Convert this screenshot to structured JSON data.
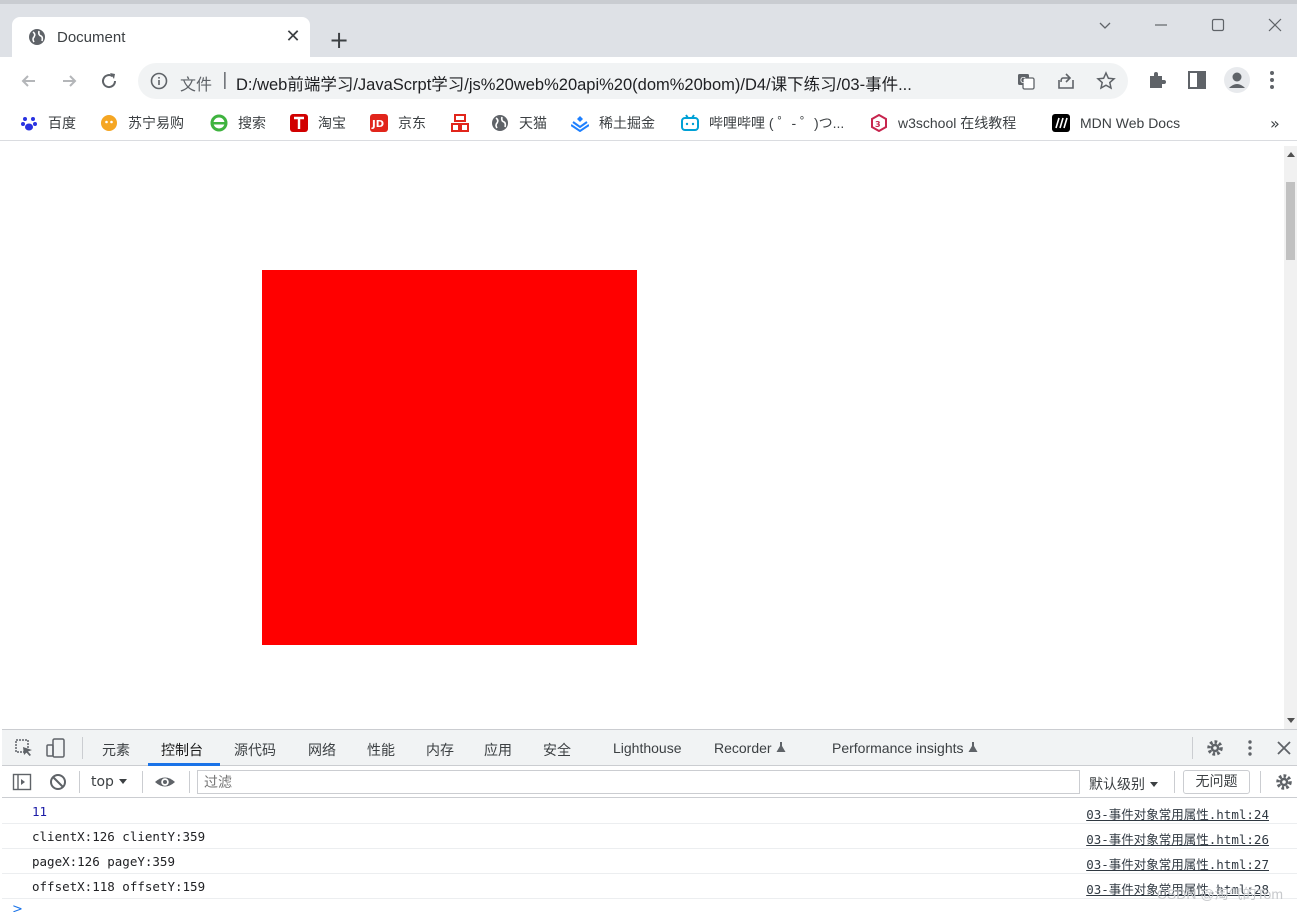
{
  "tab": {
    "title": "Document",
    "close_glyph": "✕"
  },
  "window": {
    "new_tab_glyph": "+"
  },
  "omnibox": {
    "scheme_label": "文件",
    "separator": "|",
    "url": "D:/web前端学习/JavaScrpt学习/js%20web%20api%20(dom%20bom)/D4/课下练习/03-事件..."
  },
  "bookmarks": [
    {
      "label": "百度",
      "icon": "baidu-icon",
      "color": "#2932e1"
    },
    {
      "label": "苏宁易购",
      "icon": "suning-icon",
      "color": "#f5a623"
    },
    {
      "label": "搜索",
      "icon": "search-engine-icon",
      "color": "#3fb33f"
    },
    {
      "label": "淘宝",
      "icon": "taobao-icon",
      "color": "#d10000"
    },
    {
      "label": "京东",
      "icon": "jd-icon",
      "color": "#e1251b"
    },
    {
      "label": "",
      "icon": "grid-logo-icon",
      "color": "#e1251b"
    },
    {
      "label": "天猫",
      "icon": "globe-icon",
      "color": "#5f6368"
    },
    {
      "label": "稀土掘金",
      "icon": "juejin-icon",
      "color": "#1e80ff"
    },
    {
      "label": "哔哩哔哩 ( ゜- ゜)つ...",
      "icon": "bilibili-icon",
      "color": "#00a1d6"
    },
    {
      "label": "w3school 在线教程",
      "icon": "w3school-icon",
      "color": "#c7254e"
    },
    {
      "label": "MDN Web Docs",
      "icon": "mdn-icon",
      "color": "#000000"
    }
  ],
  "bookmarks_overflow": "»",
  "page": {
    "box_color": "#ff0000"
  },
  "devtools": {
    "tabs": [
      "元素",
      "控制台",
      "源代码",
      "网络",
      "性能",
      "内存",
      "应用",
      "安全",
      "Lighthouse",
      "Recorder",
      "Performance insights"
    ],
    "active_tab": "控制台",
    "context": "top",
    "filter_placeholder": "过滤",
    "level": "默认级别",
    "issues": "无问题",
    "messages": [
      {
        "text": "11",
        "source": "03-事件对象常用属性.html:24"
      },
      {
        "text": "clientX:126 clientY:359",
        "source": "03-事件对象常用属性.html:26"
      },
      {
        "text": "pageX:126 pageY:359",
        "source": "03-事件对象常用属性.html:27"
      },
      {
        "text": "offsetX:118 offsetY:159",
        "source": "03-事件对象常用属性.html:28"
      }
    ],
    "prompt": ">"
  },
  "watermark": "CSDN @淘气的Tom"
}
